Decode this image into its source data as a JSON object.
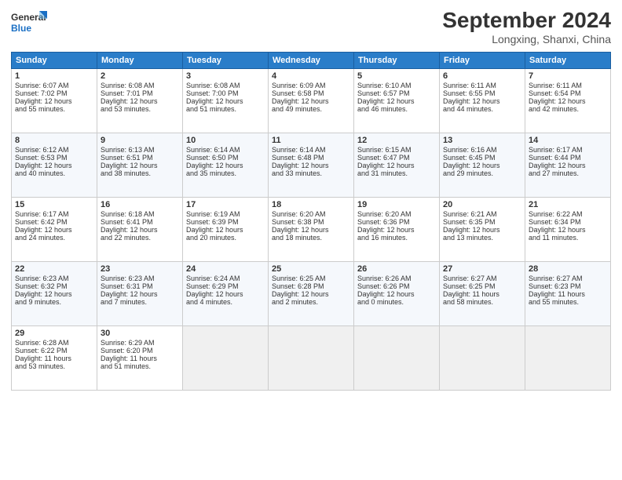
{
  "header": {
    "logo_line1": "General",
    "logo_line2": "Blue",
    "month_title": "September 2024",
    "location": "Longxing, Shanxi, China"
  },
  "weekdays": [
    "Sunday",
    "Monday",
    "Tuesday",
    "Wednesday",
    "Thursday",
    "Friday",
    "Saturday"
  ],
  "weeks": [
    [
      {
        "day": "1",
        "lines": [
          "Sunrise: 6:07 AM",
          "Sunset: 7:02 PM",
          "Daylight: 12 hours",
          "and 55 minutes."
        ]
      },
      {
        "day": "2",
        "lines": [
          "Sunrise: 6:08 AM",
          "Sunset: 7:01 PM",
          "Daylight: 12 hours",
          "and 53 minutes."
        ]
      },
      {
        "day": "3",
        "lines": [
          "Sunrise: 6:08 AM",
          "Sunset: 7:00 PM",
          "Daylight: 12 hours",
          "and 51 minutes."
        ]
      },
      {
        "day": "4",
        "lines": [
          "Sunrise: 6:09 AM",
          "Sunset: 6:58 PM",
          "Daylight: 12 hours",
          "and 49 minutes."
        ]
      },
      {
        "day": "5",
        "lines": [
          "Sunrise: 6:10 AM",
          "Sunset: 6:57 PM",
          "Daylight: 12 hours",
          "and 46 minutes."
        ]
      },
      {
        "day": "6",
        "lines": [
          "Sunrise: 6:11 AM",
          "Sunset: 6:55 PM",
          "Daylight: 12 hours",
          "and 44 minutes."
        ]
      },
      {
        "day": "7",
        "lines": [
          "Sunrise: 6:11 AM",
          "Sunset: 6:54 PM",
          "Daylight: 12 hours",
          "and 42 minutes."
        ]
      }
    ],
    [
      {
        "day": "8",
        "lines": [
          "Sunrise: 6:12 AM",
          "Sunset: 6:53 PM",
          "Daylight: 12 hours",
          "and 40 minutes."
        ]
      },
      {
        "day": "9",
        "lines": [
          "Sunrise: 6:13 AM",
          "Sunset: 6:51 PM",
          "Daylight: 12 hours",
          "and 38 minutes."
        ]
      },
      {
        "day": "10",
        "lines": [
          "Sunrise: 6:14 AM",
          "Sunset: 6:50 PM",
          "Daylight: 12 hours",
          "and 35 minutes."
        ]
      },
      {
        "day": "11",
        "lines": [
          "Sunrise: 6:14 AM",
          "Sunset: 6:48 PM",
          "Daylight: 12 hours",
          "and 33 minutes."
        ]
      },
      {
        "day": "12",
        "lines": [
          "Sunrise: 6:15 AM",
          "Sunset: 6:47 PM",
          "Daylight: 12 hours",
          "and 31 minutes."
        ]
      },
      {
        "day": "13",
        "lines": [
          "Sunrise: 6:16 AM",
          "Sunset: 6:45 PM",
          "Daylight: 12 hours",
          "and 29 minutes."
        ]
      },
      {
        "day": "14",
        "lines": [
          "Sunrise: 6:17 AM",
          "Sunset: 6:44 PM",
          "Daylight: 12 hours",
          "and 27 minutes."
        ]
      }
    ],
    [
      {
        "day": "15",
        "lines": [
          "Sunrise: 6:17 AM",
          "Sunset: 6:42 PM",
          "Daylight: 12 hours",
          "and 24 minutes."
        ]
      },
      {
        "day": "16",
        "lines": [
          "Sunrise: 6:18 AM",
          "Sunset: 6:41 PM",
          "Daylight: 12 hours",
          "and 22 minutes."
        ]
      },
      {
        "day": "17",
        "lines": [
          "Sunrise: 6:19 AM",
          "Sunset: 6:39 PM",
          "Daylight: 12 hours",
          "and 20 minutes."
        ]
      },
      {
        "day": "18",
        "lines": [
          "Sunrise: 6:20 AM",
          "Sunset: 6:38 PM",
          "Daylight: 12 hours",
          "and 18 minutes."
        ]
      },
      {
        "day": "19",
        "lines": [
          "Sunrise: 6:20 AM",
          "Sunset: 6:36 PM",
          "Daylight: 12 hours",
          "and 16 minutes."
        ]
      },
      {
        "day": "20",
        "lines": [
          "Sunrise: 6:21 AM",
          "Sunset: 6:35 PM",
          "Daylight: 12 hours",
          "and 13 minutes."
        ]
      },
      {
        "day": "21",
        "lines": [
          "Sunrise: 6:22 AM",
          "Sunset: 6:34 PM",
          "Daylight: 12 hours",
          "and 11 minutes."
        ]
      }
    ],
    [
      {
        "day": "22",
        "lines": [
          "Sunrise: 6:23 AM",
          "Sunset: 6:32 PM",
          "Daylight: 12 hours",
          "and 9 minutes."
        ]
      },
      {
        "day": "23",
        "lines": [
          "Sunrise: 6:23 AM",
          "Sunset: 6:31 PM",
          "Daylight: 12 hours",
          "and 7 minutes."
        ]
      },
      {
        "day": "24",
        "lines": [
          "Sunrise: 6:24 AM",
          "Sunset: 6:29 PM",
          "Daylight: 12 hours",
          "and 4 minutes."
        ]
      },
      {
        "day": "25",
        "lines": [
          "Sunrise: 6:25 AM",
          "Sunset: 6:28 PM",
          "Daylight: 12 hours",
          "and 2 minutes."
        ]
      },
      {
        "day": "26",
        "lines": [
          "Sunrise: 6:26 AM",
          "Sunset: 6:26 PM",
          "Daylight: 12 hours",
          "and 0 minutes."
        ]
      },
      {
        "day": "27",
        "lines": [
          "Sunrise: 6:27 AM",
          "Sunset: 6:25 PM",
          "Daylight: 11 hours",
          "and 58 minutes."
        ]
      },
      {
        "day": "28",
        "lines": [
          "Sunrise: 6:27 AM",
          "Sunset: 6:23 PM",
          "Daylight: 11 hours",
          "and 55 minutes."
        ]
      }
    ],
    [
      {
        "day": "29",
        "lines": [
          "Sunrise: 6:28 AM",
          "Sunset: 6:22 PM",
          "Daylight: 11 hours",
          "and 53 minutes."
        ]
      },
      {
        "day": "30",
        "lines": [
          "Sunrise: 6:29 AM",
          "Sunset: 6:20 PM",
          "Daylight: 11 hours",
          "and 51 minutes."
        ]
      },
      {
        "day": "",
        "lines": []
      },
      {
        "day": "",
        "lines": []
      },
      {
        "day": "",
        "lines": []
      },
      {
        "day": "",
        "lines": []
      },
      {
        "day": "",
        "lines": []
      }
    ]
  ]
}
